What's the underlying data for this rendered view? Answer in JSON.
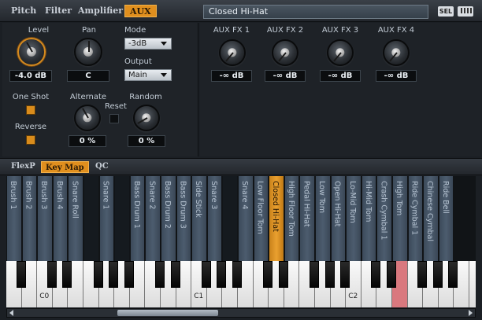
{
  "tabs": [
    "Pitch",
    "Filter",
    "Amplifier",
    "AUX"
  ],
  "preset_name": "Closed Hi-Hat",
  "sel_label": "SEL",
  "left": {
    "level_label": "Level",
    "level_value": "-4.0 dB",
    "pan_label": "Pan",
    "pan_value": "C",
    "mode_label": "Mode",
    "mode_value": "-3dB",
    "output_label": "Output",
    "output_value": "Main",
    "oneshot_label": "One Shot",
    "reverse_label": "Reverse",
    "alternate_label": "Alternate",
    "alternate_value": "0 %",
    "reset_label": "Reset",
    "random_label": "Random",
    "random_value": "0 %"
  },
  "aux": [
    {
      "label": "AUX FX 1",
      "value": "-∞ dB"
    },
    {
      "label": "AUX FX 2",
      "value": "-∞ dB"
    },
    {
      "label": "AUX FX 3",
      "value": "-∞ dB"
    },
    {
      "label": "AUX FX 4",
      "value": "-∞ dB"
    }
  ],
  "section_tabs": [
    "FlexP",
    "Key Map",
    "QC"
  ],
  "keymap": {
    "lanes": [
      "Brush 1",
      "Brush 2",
      "Brush 3",
      "Brush 4",
      "Snare Roll",
      "",
      "Snare 1",
      "",
      "Bass Drum 1",
      "Snare 2",
      "Bass Drum 2",
      "Bass Drum 3",
      "Side Stick",
      "Snare 3",
      "",
      "Snare 4",
      "Low Floor Tom",
      "Closed Hi-Hat",
      "High Floor Tom",
      "Pedal Hi-Hat",
      "Low Tom",
      "Open Hi-Hat",
      "Lo-Mid Tom",
      "Hi-Mid Tom",
      "Crash Cymbal 1",
      "High Tom",
      "Ride Cymbal 1",
      "Chinese Cymbal",
      "Ride Bell"
    ],
    "selected_lane": "Closed Hi-Hat",
    "key_labels": [
      "C0",
      "C1",
      "C2"
    ]
  },
  "colors": {
    "accent": "#e08f1e",
    "lane": "#46566a",
    "pressed_key": "#d9787e"
  }
}
